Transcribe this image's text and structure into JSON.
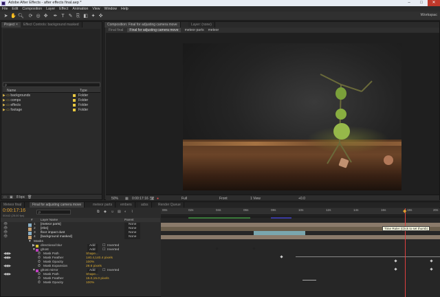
{
  "app": {
    "title": "Adobe After Effects - after effects final.aep *",
    "window_buttons": [
      "–",
      "□",
      "✕"
    ]
  },
  "menu": [
    "File",
    "Edit",
    "Composition",
    "Layer",
    "Effect",
    "Animation",
    "View",
    "Window",
    "Help"
  ],
  "toolbar": {
    "workspace": "Workspac",
    "tools": [
      "selection-tool",
      "hand-tool",
      "zoom-tool",
      "rotate-tool",
      "camera-tool",
      "pan-behind-tool",
      "pen-tool",
      "type-tool",
      "brush-tool",
      "clone-tool",
      "eraser-tool",
      "roto-tool",
      "puppet-tool"
    ]
  },
  "project": {
    "tabs": [
      "Project ×",
      "Effect Controls: background masked"
    ],
    "search_placeholder": "ρ",
    "columns": {
      "name": "Name",
      "type": "Type"
    },
    "items": [
      {
        "name": "backgrounds",
        "type": "Folder"
      },
      {
        "name": "comps",
        "type": "Folder"
      },
      {
        "name": "effects",
        "type": "Folder"
      },
      {
        "name": "footage",
        "type": "Folder"
      }
    ],
    "bpc": "8 bpc"
  },
  "composition": {
    "tab": "Composition: Final for adjusting camera move",
    "layer_tab": "Layer: (none)",
    "breadcrumb": [
      "Final final",
      "Final for adjusting camera move",
      "meteor parts",
      "meteor"
    ],
    "footer": {
      "zoom": "50%",
      "timecode": "0:00:17:16",
      "resolution": "Full",
      "view": "Front",
      "views": "1 View",
      "offset": "+0.0"
    }
  },
  "timeline": {
    "tabs": [
      "Meteor final",
      "Final for adjusting camera move",
      "meteor parts",
      "embers",
      "adss",
      "Render Queue"
    ],
    "timecode": "0:00:17:16",
    "fps": "00442 (25.00 fps)",
    "search_placeholder": "ρ",
    "columns": {
      "num": "#",
      "layer": "Layer Name",
      "parent": "Parent"
    },
    "ruler": [
      "00s",
      "02s",
      "04s",
      "06s",
      "08s",
      "10s",
      "12s",
      "14s",
      "16s",
      "18s",
      "20s"
    ],
    "tooltip": "Time Ruler (Click to set thumb)",
    "layers": [
      {
        "num": "1",
        "name": "[meteor parts]",
        "parent": "None"
      },
      {
        "num": "2",
        "name": "[rrbs]",
        "parent": "None"
      },
      {
        "num": "3",
        "name": "floor impact dust",
        "parent": "None"
      },
      {
        "num": "4",
        "name": "[background masked]",
        "parent": "None"
      }
    ],
    "masks_label": "Masks",
    "mask_rows": [
      {
        "label": "directional blur",
        "mode": "Add",
        "inverted": "Inverted"
      },
      {
        "label": "ghost",
        "mode": "Add",
        "inverted": "Inverted"
      }
    ],
    "ghost_props": [
      {
        "label": "Mask Path",
        "value": "Shape..."
      },
      {
        "label": "Mask Feather",
        "value": "140.4,140.4 pixels"
      },
      {
        "label": "Mask Opacity",
        "value": "100%"
      },
      {
        "label": "Mask Expansion",
        "value": "29.6 pixels"
      }
    ],
    "ghost_mirror": {
      "label": "ghost mirror",
      "mode": "Add",
      "inverted": "Inverted"
    },
    "mirror_props": [
      {
        "label": "Mask Path",
        "value": "Shape..."
      },
      {
        "label": "Mask Feather",
        "value": "15.0,15.0 pixels"
      },
      {
        "label": "Mask Opacity",
        "value": "100%"
      }
    ]
  }
}
